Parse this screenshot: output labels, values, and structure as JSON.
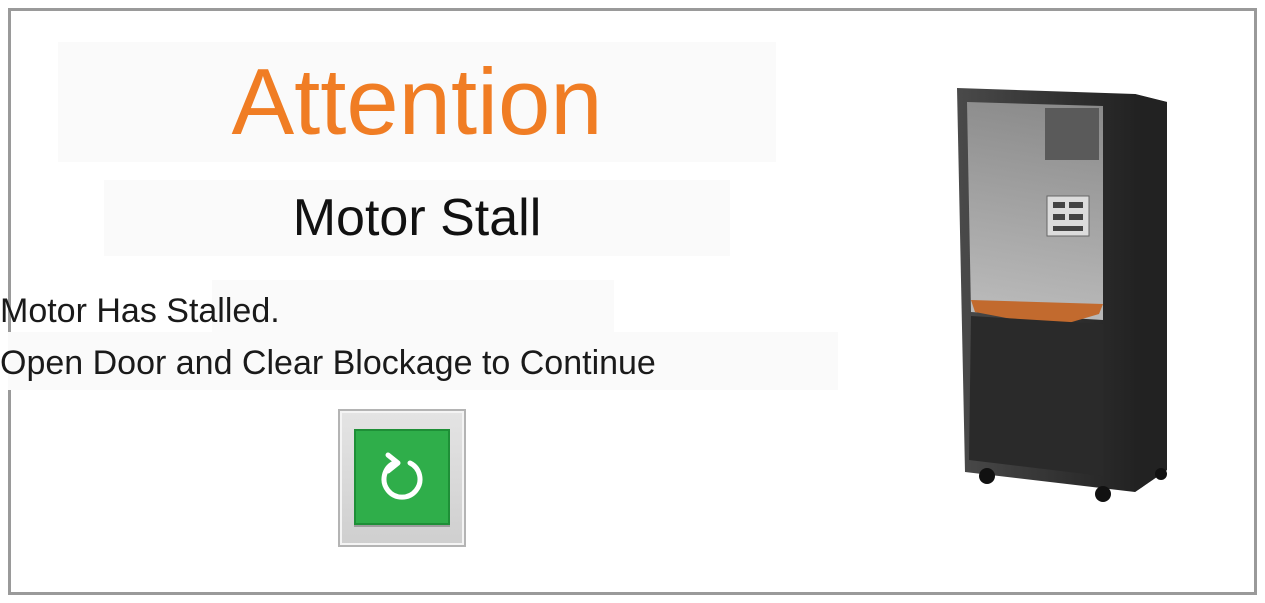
{
  "alert": {
    "title": "Attention",
    "subtitle": "Motor Stall",
    "message_line1": "Motor Has Stalled.",
    "message_line2": "Open Door and Clear Blockage to Continue"
  },
  "button": {
    "icon": "refresh-icon",
    "color": "#2fae4a"
  },
  "image": {
    "subject": "machine-image"
  },
  "colors": {
    "title": "#f07d24",
    "border": "#9a9a9a"
  }
}
